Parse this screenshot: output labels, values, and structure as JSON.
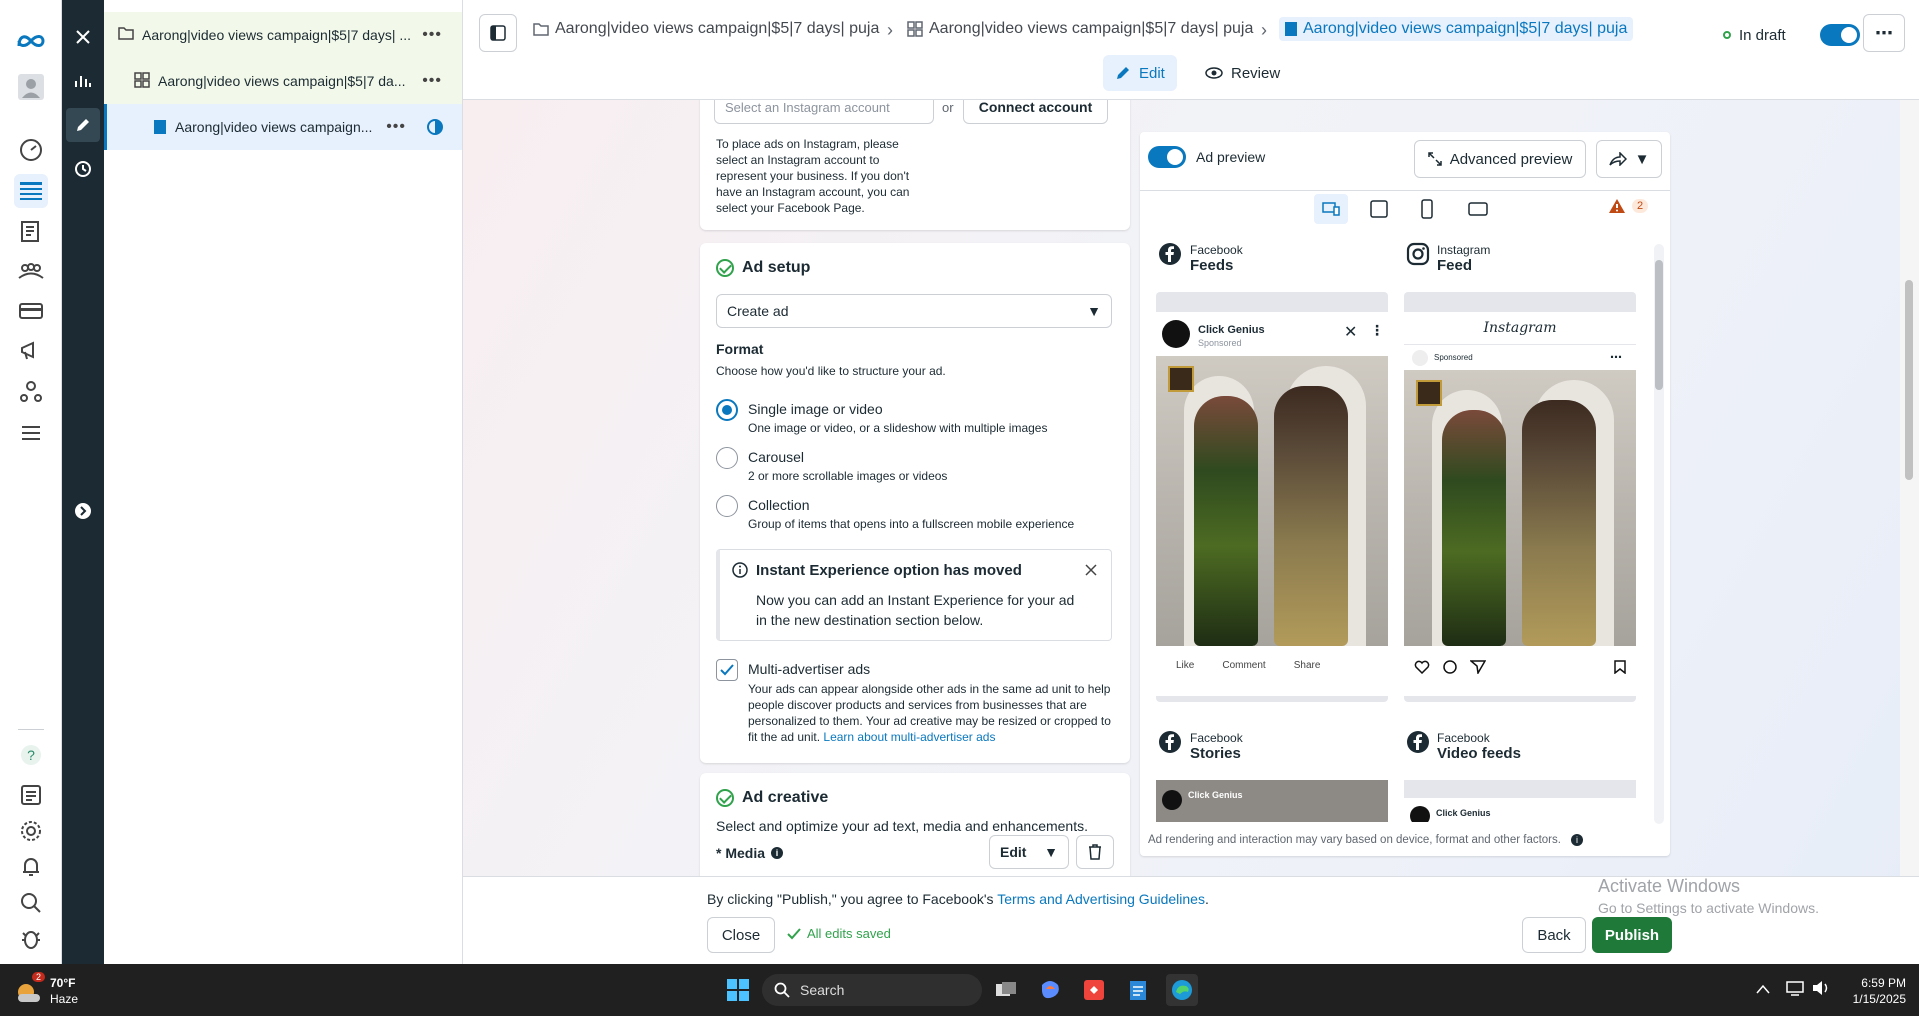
{
  "tree": {
    "items": [
      {
        "label": "Aarong|video views campaign|$5|7 days| ..."
      },
      {
        "label": "Aarong|video views campaign|$5|7 da..."
      },
      {
        "label": "Aarong|video views campaign..."
      }
    ]
  },
  "header": {
    "breadcrumbs": [
      "Aarong|video views campaign|$5|7 days| puja",
      "Aarong|video views campaign|$5|7 days| puja",
      "Aarong|video views campaign|$5|7 days| puja"
    ],
    "status": "In draft",
    "tabs": {
      "edit": "Edit",
      "review": "Review"
    }
  },
  "identity": {
    "instagram_placeholder": "Select an Instagram account",
    "or": "or",
    "connect": "Connect account",
    "help": "To place ads on Instagram, please select an Instagram account to represent your business. If you don't have an Instagram account, you can select your Facebook Page."
  },
  "ad_setup": {
    "title": "Ad setup",
    "select_value": "Create ad",
    "format_label": "Format",
    "format_help": "Choose how you'd like to structure your ad.",
    "options": [
      {
        "title": "Single image or video",
        "sub": "One image or video, or a slideshow with multiple images",
        "selected": true
      },
      {
        "title": "Carousel",
        "sub": "2 or more scrollable images or videos",
        "selected": false
      },
      {
        "title": "Collection",
        "sub": "Group of items that opens into a fullscreen mobile experience",
        "selected": false
      }
    ],
    "notice_title": "Instant Experience option has moved",
    "notice_body": "Now you can add an Instant Experience for your ad in the new destination section below.",
    "multi_title": "Multi-advertiser ads",
    "multi_body": "Your ads can appear alongside other ads in the same ad unit to help people discover products and services from businesses that are personalized to them. Your ad creative may be resized or cropped to fit the ad unit.",
    "multi_link": "Learn about multi-advertiser ads",
    "multi_checked": true
  },
  "ad_creative": {
    "title": "Ad creative",
    "sub": "Select and optimize your ad text, media and enhancements.",
    "media_label": "* Media",
    "edit_label": "Edit"
  },
  "preview": {
    "toggle_label": "Ad preview",
    "advanced": "Advanced preview",
    "warning_count": "2",
    "placements": [
      {
        "platform": "Facebook",
        "name": "Feeds"
      },
      {
        "platform": "Instagram",
        "name": "Feed"
      },
      {
        "platform": "Facebook",
        "name": "Stories"
      },
      {
        "platform": "Facebook",
        "name": "Video feeds"
      }
    ],
    "page_name": "Click Genius",
    "sponsored": "Sponsored",
    "instagram_wordmark": "Instagram",
    "fb_actions": [
      "Like",
      "Comment",
      "Share"
    ],
    "footer": "Ad rendering and interaction may vary based on device, format and other factors."
  },
  "bottom": {
    "agree_prefix": "By clicking \"Publish,\" you agree to Facebook's",
    "agree_link": "Terms and Advertising Guidelines",
    "agree_suffix": ".",
    "close": "Close",
    "saved": "All edits saved",
    "back": "Back",
    "publish": "Publish"
  },
  "watermark": {
    "line1": "Activate Windows",
    "line2": "Go to Settings to activate Windows."
  },
  "taskbar": {
    "weather_temp": "70°F",
    "weather_desc": "Haze",
    "weather_badge": "2",
    "search": "Search",
    "time": "6:59 PM",
    "date": "1/15/2025"
  },
  "colors": {
    "accent": "#0a78be",
    "publish": "#1f7a3a",
    "success": "#31a24c",
    "warning": "#e0681b"
  }
}
